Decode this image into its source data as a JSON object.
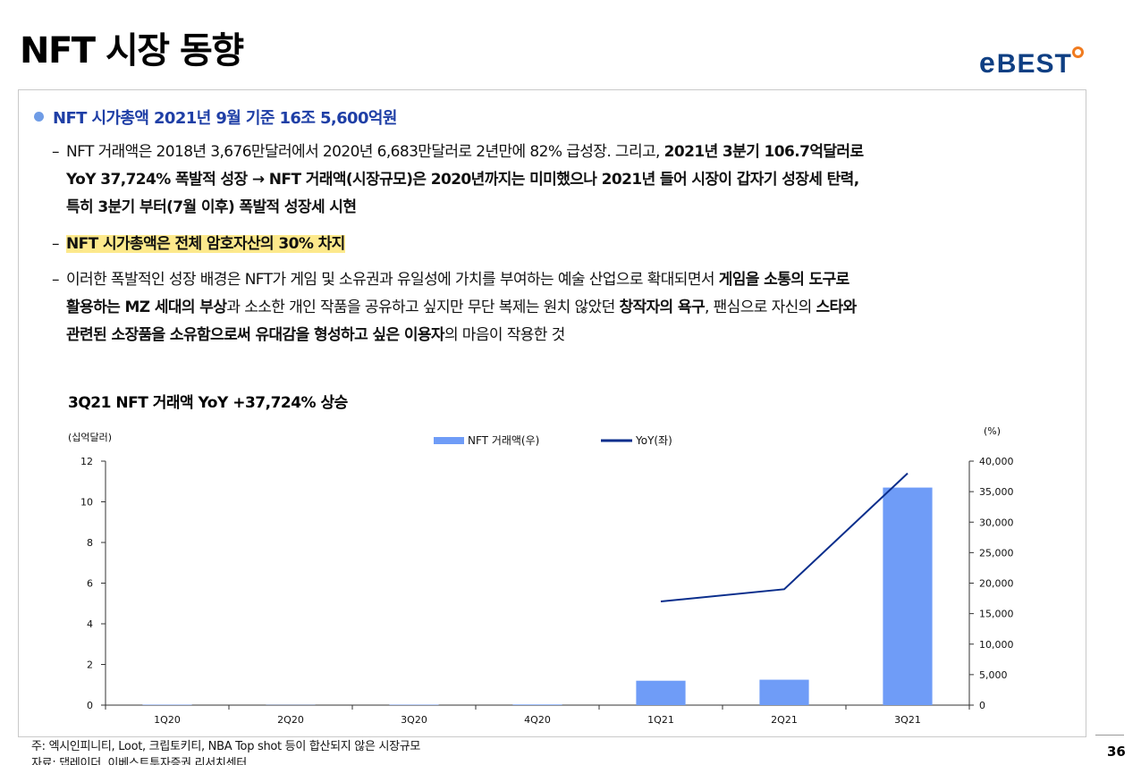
{
  "header": {
    "title": "NFT 시장 동향",
    "logo_text": "BEST",
    "logo_e": "e"
  },
  "content": {
    "headline": "NFT 시가총액  2021년 9월 기준 16조 5,600억원",
    "p1_line1_a": "NFT 거래액은 2018년 3,676만달러에서 2020년 6,683만달러로 2년만에 82% 급성장. 그리고, ",
    "p1_line1_b": "2021년 3분기 106.7억달러로",
    "p1_line2": "YoY 37,724% 폭발적 성장 → NFT 거래액(시장규모)은 2020년까지는 미미했으나 2021년 들어 시장이 갑자기 성장세 탄력,",
    "p1_line3": "특히 3분기 부터(7월 이후) 폭발적 성장세 시현",
    "p2": "NFT 시가총액은 전체 암호자산의 30% 차지",
    "p3_line1_a": "이러한 폭발적인 성장 배경은 NFT가 게임 및 소유권과 유일성에 가치를 부여하는 예술 산업으로 확대되면서 ",
    "p3_line1_b": "게임을 소통의 도구로",
    "p3_line2_a": "활용하는 MZ 세대의 부상",
    "p3_line2_b": "과 소소한 개인 작품을 공유하고 싶지만 무단 복제는 원치 않았던 ",
    "p3_line2_c": "창작자의 욕구",
    "p3_line2_d": ", 팬심으로 자신의 ",
    "p3_line2_e": "스타와",
    "p3_line3_a": "관련된 소장품을 소유함으로써 유대감을 형성하고 싶은 이용자",
    "p3_line3_b": "의 마음이 작용한 것",
    "dash": "–"
  },
  "chart_data": {
    "type": "bar",
    "title": "3Q21 NFT 거래액 YoY +37,724% 상승",
    "categories": [
      "1Q20",
      "2Q20",
      "3Q20",
      "4Q20",
      "1Q21",
      "2Q21",
      "3Q21"
    ],
    "series": [
      {
        "name": "NFT 거래액(우)",
        "type": "bar",
        "axis": "left",
        "color": "#6f9cf7",
        "values": [
          0.02,
          0.01,
          0.02,
          0.03,
          1.2,
          1.25,
          10.7
        ]
      },
      {
        "name": "YoY(좌)",
        "type": "line",
        "axis": "right",
        "color": "#0a2e8c",
        "values": [
          null,
          null,
          null,
          null,
          17000,
          19000,
          38000
        ]
      }
    ],
    "ylabel_left": "(십억달러)",
    "ylabel_right": "(%)",
    "ylim_left": [
      0,
      12
    ],
    "yticks_left": [
      0,
      2,
      4,
      6,
      8,
      10,
      12
    ],
    "ylim_right": [
      0,
      40000
    ],
    "yticks_right": [
      "0",
      "5,000",
      "10,000",
      "15,000",
      "20,000",
      "25,000",
      "30,000",
      "35,000",
      "40,000"
    ],
    "legend_position": "top",
    "grid": false
  },
  "footer": {
    "note": "주: 엑시인피니티, Loot, 크립토키티, NBA Top shot 등이 합산되지 않은 시장규모",
    "source": "자료: 댑레이더, 이베스트투자증권 리서치센터",
    "page": "36"
  }
}
